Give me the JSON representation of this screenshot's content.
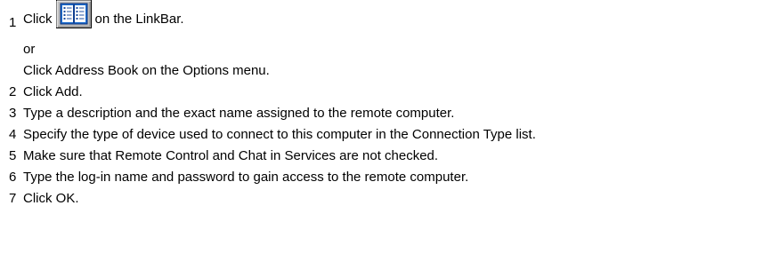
{
  "steps": [
    {
      "number": "1",
      "before_icon": "Click",
      "icon": "address-book-icon",
      "after_icon": "on the LinkBar.",
      "or_label": "or",
      "alternative": "Click Address Book on the Options menu."
    },
    {
      "number": "2",
      "text": "Click Add."
    },
    {
      "number": "3",
      "text": "Type a description and the exact name assigned to the remote computer."
    },
    {
      "number": "4",
      "text": "Specify the type of device used to connect to this computer in the Connection Type list."
    },
    {
      "number": "5",
      "text": "Make sure that Remote Control and Chat in Services are not checked."
    },
    {
      "number": "6",
      "text": "Type the log-in name and password to gain access to the remote computer."
    },
    {
      "number": "7",
      "text": "Click OK."
    }
  ]
}
